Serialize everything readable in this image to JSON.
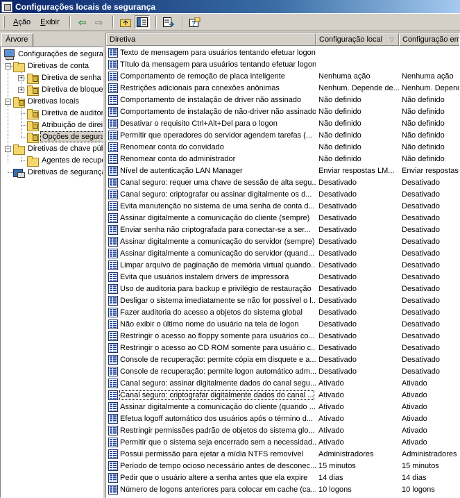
{
  "window": {
    "title": "Configurações locais de segurança"
  },
  "menu": {
    "acao": "Ação",
    "exibir": "Exibir"
  },
  "tab_label": "Árvore",
  "tree": {
    "root": "Configurações de segurança",
    "n1": "Diretivas de conta",
    "n1a": "Diretiva de senha",
    "n1b": "Diretiva de bloqueio",
    "n2": "Diretivas locais",
    "n2a": "Diretiva de auditoria",
    "n2b": "Atribuição de direitos",
    "n2c": "Opções de segurança",
    "n3": "Diretivas de chave pública",
    "n3a": "Agentes de recuperação",
    "n4": "Diretivas de segurança IP"
  },
  "columns": {
    "diretiva": "Diretiva",
    "local": "Configuração local",
    "efetiva": "Configuração em vigor"
  },
  "rows": [
    {
      "p": "Texto de mensagem para usuários tentando efetuar logon",
      "l": "",
      "e": ""
    },
    {
      "p": "Título da mensagem para usuários tentando efetuar logon",
      "l": "",
      "e": ""
    },
    {
      "p": "Comportamento de remoção de placa inteligente",
      "l": "Nenhuma ação",
      "e": "Nenhuma ação"
    },
    {
      "p": "Restrições adicionais para conexões anônimas",
      "l": "Nenhum. Depende de...",
      "e": "Nenhum. Depende"
    },
    {
      "p": "Comportamento de instalação de driver não assinado",
      "l": "Não definido",
      "e": "Não definido"
    },
    {
      "p": "Comportamento de instalação de não-driver não assinado",
      "l": "Não definido",
      "e": "Não definido"
    },
    {
      "p": "Desativar o requisito Ctrl+Alt+Del para o logon",
      "l": "Não definido",
      "e": "Não definido"
    },
    {
      "p": "Permitir que operadores do servidor agendem tarefas (...",
      "l": "Não definido",
      "e": "Não definido"
    },
    {
      "p": "Renomear conta do convidado",
      "l": "Não definido",
      "e": "Não definido"
    },
    {
      "p": "Renomear conta do administrador",
      "l": "Não definido",
      "e": "Não definido"
    },
    {
      "p": "Nível de autenticação LAN Manager",
      "l": "Enviar respostas LM...",
      "e": "Enviar respostas"
    },
    {
      "p": "Canal seguro: requer uma chave de sessão de alta segu...",
      "l": "Desativado",
      "e": "Desativado"
    },
    {
      "p": "Canal seguro: criptografar ou assinar digitalmente os d...",
      "l": "Desativado",
      "e": "Desativado"
    },
    {
      "p": "Evita manutenção no sistema de uma senha de conta d...",
      "l": "Desativado",
      "e": "Desativado"
    },
    {
      "p": "Assinar digitalmente a comunicação do cliente (sempre)",
      "l": "Desativado",
      "e": "Desativado"
    },
    {
      "p": "Enviar senha não criptografada para conectar-se a ser...",
      "l": "Desativado",
      "e": "Desativado"
    },
    {
      "p": "Assinar digitalmente a comunicação do servidor (sempre)",
      "l": "Desativado",
      "e": "Desativado"
    },
    {
      "p": "Assinar digitalmente a comunicação do servidor (quand...",
      "l": "Desativado",
      "e": "Desativado"
    },
    {
      "p": "Limpar arquivo de paginação de memória virtual quando...",
      "l": "Desativado",
      "e": "Desativado"
    },
    {
      "p": "Evita que usuários instalem drivers de impressora",
      "l": "Desativado",
      "e": "Desativado"
    },
    {
      "p": "Uso de auditoria para backup e privilégio de restauração",
      "l": "Desativado",
      "e": "Desativado"
    },
    {
      "p": "Desligar o sistema imediatamente se não for possível o l...",
      "l": "Desativado",
      "e": "Desativado"
    },
    {
      "p": "Fazer auditoria do acesso a objetos do sistema global",
      "l": "Desativado",
      "e": "Desativado"
    },
    {
      "p": "Não exibir o último nome do usuário na tela de logon",
      "l": "Desativado",
      "e": "Desativado"
    },
    {
      "p": "Restringir o acesso ao floppy somente para usuários co...",
      "l": "Desativado",
      "e": "Desativado"
    },
    {
      "p": "Restringir o acesso ao CD ROM somente para usuário c...",
      "l": "Desativado",
      "e": "Desativado"
    },
    {
      "p": "Console de recuperação: permite cópia em disquete e a...",
      "l": "Desativado",
      "e": "Desativado"
    },
    {
      "p": "Console de recuperação: permite logon automático adm...",
      "l": "Desativado",
      "e": "Desativado"
    },
    {
      "p": "Canal seguro: assinar digitalmente dados do canal segu...",
      "l": "Ativado",
      "e": "Ativado"
    },
    {
      "p": "Canal seguro: criptografar digitalmente dados do canal ...",
      "l": "Ativado",
      "e": "Ativado"
    },
    {
      "p": "Assinar digitalmente a comunicação do cliente (quando ...",
      "l": "Ativado",
      "e": "Ativado"
    },
    {
      "p": "Efetua logoff automático dos usuários após o término d...",
      "l": "Ativado",
      "e": "Ativado"
    },
    {
      "p": "Restringir permissões padrão de objetos do sistema glo...",
      "l": "Ativado",
      "e": "Ativado"
    },
    {
      "p": "Permitir que o sistema seja encerrado sem a necessidad...",
      "l": "Ativado",
      "e": "Ativado"
    },
    {
      "p": "Possui permissão para ejetar a mídia NTFS removível",
      "l": "Administradores",
      "e": "Administradores"
    },
    {
      "p": "Período de tempo ocioso necessário antes de desconec...",
      "l": "15 minutos",
      "e": "15 minutos"
    },
    {
      "p": "Pedir que o usuário altere a senha antes que ela expire",
      "l": "14 dias",
      "e": "14 dias"
    },
    {
      "p": "Número de logons anteriores para colocar em cache (ca...",
      "l": "10 logons",
      "e": "10 logons"
    }
  ]
}
